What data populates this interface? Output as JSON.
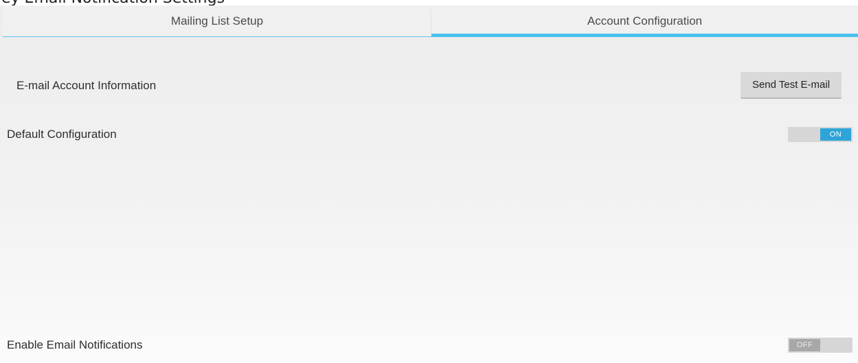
{
  "header_strip": {
    "text": "ey   Email Notification Settings"
  },
  "tabs": [
    {
      "label": "Mailing List Setup",
      "selected": false
    },
    {
      "label": "Account Configuration",
      "selected": true
    }
  ],
  "email_account": {
    "label": "E-mail Account Information",
    "test_button_label": "Send Test E-mail"
  },
  "default_config": {
    "label": "Default Configuration",
    "toggle_state": "ON"
  },
  "notifications": {
    "label": "Enable Email Notifications",
    "toggle_state": "OFF"
  },
  "colors": {
    "accent": "#4ac1ee",
    "toggle_on": "#2ea4d8",
    "toggle_off": "#a8a8a8"
  }
}
